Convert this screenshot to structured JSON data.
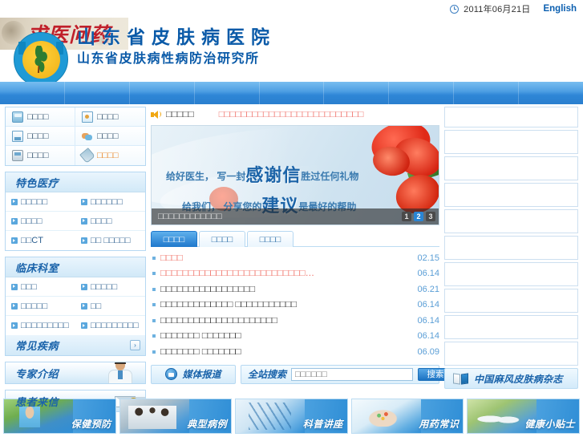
{
  "topbar": {
    "date": "2011年06月21日",
    "language_link": "English",
    "clock_icon": "clock-icon"
  },
  "header": {
    "calligraphy_text": "求医问药",
    "title_main": "山东省皮肤病医院",
    "title_sub": "山东省皮肤病性病防治研究所"
  },
  "navbar": {
    "items": [
      "",
      "",
      "",
      "",
      "",
      "",
      "",
      "",
      ""
    ]
  },
  "sidebar": {
    "quicklinks": [
      {
        "label": "□□□□",
        "icon": "bus-icon",
        "highlight": false
      },
      {
        "label": "□□□□",
        "icon": "id-card-icon",
        "highlight": false
      },
      {
        "label": "□□□□",
        "icon": "document-icon",
        "highlight": false
      },
      {
        "label": "□□□□",
        "icon": "chat-icon",
        "highlight": false
      },
      {
        "label": "□□□□",
        "icon": "mobile-phone-icon",
        "highlight": false
      },
      {
        "label": "□□□□",
        "icon": "pen-icon",
        "highlight": true
      }
    ],
    "featured": {
      "title": "特色医疗",
      "links": [
        "□□□□□",
        "□□□□□□",
        "□□□□",
        "□□□□",
        "□□CT",
        "□□ □□□□□"
      ]
    },
    "clinical": {
      "title": "临床科室",
      "links": [
        "□□□",
        "□□□□□",
        "□□□□□",
        "□□",
        "□□□□□□□□□",
        "□□□□□□□□□"
      ]
    },
    "common_diseases": {
      "title": "常见疾病",
      "more": "›"
    },
    "experts": {
      "title": "专家介绍"
    },
    "letters": {
      "title": "患者来信",
      "badge": "!"
    }
  },
  "notice": {
    "label": "□□□□□",
    "marquee": "□□□□□□□□□□□□□□□□□□□□□□□□□□"
  },
  "banner": {
    "line1_pre": "给好医生， 写一封",
    "line1_big": "感谢信",
    "line1_post": "胜过任何礼物",
    "line2_pre": "给我们， 分享您的",
    "line2_big": "建议",
    "line2_post": "是最好的帮助",
    "caption": "□□□□□□□□□□□□",
    "pagination": [
      "1",
      "2",
      "3"
    ],
    "active_page": "2"
  },
  "tabs": [
    {
      "label": "□□□□",
      "active": true
    },
    {
      "label": "□□□□",
      "active": false
    },
    {
      "label": "□□□□",
      "active": false
    }
  ],
  "news": [
    {
      "title": "□□□□",
      "date": "02.15",
      "red": true
    },
    {
      "title": "□□□□□□□□□□□□□□□□□□□□□□□□□□…",
      "date": "06.14",
      "red": true
    },
    {
      "title": "□□□□□□□□□□□□□□□□□",
      "date": "06.21",
      "red": false
    },
    {
      "title": "□□□□□□□□□□□□□ □□□□□□□□□□□",
      "date": "06.14",
      "red": false
    },
    {
      "title": "□□□□□□□□□□□□□□□□□□□□□",
      "date": "06.14",
      "red": false
    },
    {
      "title": "□□□□□□□ □□□□□□□",
      "date": "06.14",
      "red": false
    },
    {
      "title": "□□□□□□□ □□□□□□□",
      "date": "06.09",
      "red": false
    }
  ],
  "media": {
    "label": "媒体报道",
    "icon": "video-camera-icon"
  },
  "search": {
    "label": "全站搜索",
    "value": "",
    "placeholder": "□□□□□□",
    "button": "搜索"
  },
  "right_column": {
    "empty_boxes": 9,
    "journal": {
      "label": "中国麻风皮肤病杂志",
      "icon": "book-icon"
    }
  },
  "footer_cards": [
    {
      "label": "保健预防",
      "photo": "ph-elderly"
    },
    {
      "label": "典型病例",
      "photo": "ph-doctors"
    },
    {
      "label": "科普讲座",
      "photo": "ph-dna"
    },
    {
      "label": "用药常识",
      "photo": "ph-pills"
    },
    {
      "label": "健康小贴士",
      "photo": "ph-yoga"
    }
  ],
  "colors": {
    "brand_blue": "#0a5aa8",
    "nav_blue": "#2e86d6",
    "accent_orange": "#e8811b",
    "news_red": "#ef6a5f",
    "date_blue": "#5a9ed6"
  }
}
